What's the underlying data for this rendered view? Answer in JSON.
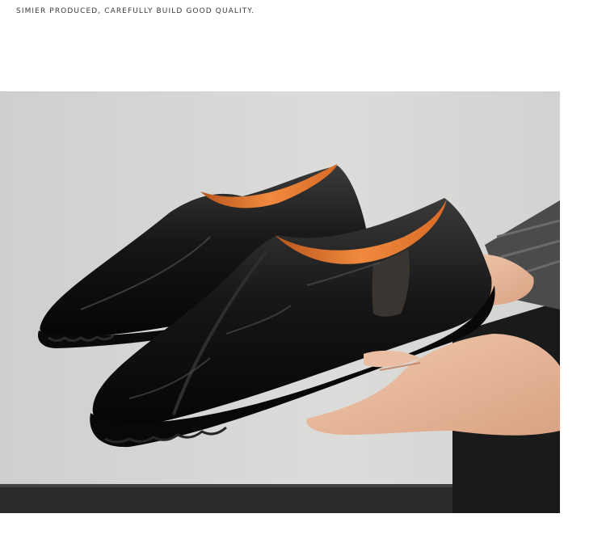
{
  "header": {
    "tagline": "SIMIER PRODUCED, CAREFULLY BUILD GOOD QUALITY."
  },
  "product_photo": {
    "subject": "black-leather-slip-on-loafers",
    "colors": {
      "background": "#d8d8d6",
      "leather": "#141414",
      "lining": "#e8772e",
      "skin": "#e8b89c",
      "sleeve": "#4a4a4a",
      "floor": "#2a2a2a"
    }
  }
}
